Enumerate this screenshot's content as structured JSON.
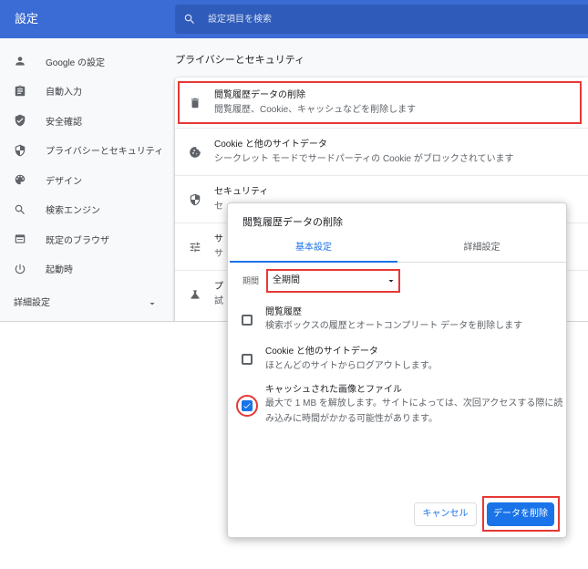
{
  "colors": {
    "toolbar_background": "#3b6cd5",
    "search_field_background": "#2f5bba",
    "accent": "#1a73e8",
    "annotation": "#e53935"
  },
  "toolbar": {
    "title": "設定",
    "search_icon": "search-icon",
    "search_placeholder": "設定項目を検索"
  },
  "sidebar": {
    "items": [
      {
        "icon": "person-icon",
        "label": "Google の設定"
      },
      {
        "icon": "clipboard-icon",
        "label": "自動入力"
      },
      {
        "icon": "verified-shield-icon",
        "label": "安全確認"
      },
      {
        "icon": "security-shield-icon",
        "label": "プライバシーとセキュリティ"
      },
      {
        "icon": "palette-icon",
        "label": "デザイン"
      },
      {
        "icon": "search-icon",
        "label": "検索エンジン"
      },
      {
        "icon": "browser-window-icon",
        "label": "既定のブラウザ"
      },
      {
        "icon": "power-icon",
        "label": "起動時"
      }
    ],
    "advanced": {
      "label": "詳細設定",
      "icon": "arrow-drop-down-icon"
    }
  },
  "privacy_section": {
    "title": "プライバシーとセキュリティ",
    "rows": [
      {
        "icon": "trash-icon",
        "title": "閲覧履歴データの削除",
        "subtitle": "閲覧履歴、Cookie、キャッシュなどを削除します",
        "highlighted": true
      },
      {
        "icon": "cookie-icon",
        "title": "Cookie と他のサイトデータ",
        "subtitle": "シークレット モードでサードパーティの Cookie がブロックされています"
      },
      {
        "icon": "security-shield-icon",
        "title": "セキュリティ",
        "subtitle": "セ"
      },
      {
        "icon": "tune-icon",
        "title": "サ",
        "subtitle": "サ"
      },
      {
        "icon": "flask-icon",
        "title": "プ",
        "subtitle": "試"
      }
    ]
  },
  "clear_data_dialog": {
    "title": "閲覧履歴データの削除",
    "tabs": [
      {
        "label": "基本設定",
        "selected": true
      },
      {
        "label": "詳細設定",
        "selected": false
      }
    ],
    "time_range": {
      "label": "期間",
      "value": "全期間",
      "icon": "arrow-drop-down-icon",
      "highlighted": true
    },
    "options": [
      {
        "title": "閲覧履歴",
        "description": [
          "検索ボックスの履歴とオートコンプリート データを削除します"
        ],
        "checked": false
      },
      {
        "title": "Cookie と他のサイトデータ",
        "description": [
          "ほとんどのサイトからログアウトします。"
        ],
        "checked": false
      },
      {
        "title": "キャッシュされた画像とファイル",
        "description": [
          "最大で 1 MB を解放します。サイトによっては、次回アクセスする際に読",
          "み込みに時間がかかる可能性があります。"
        ],
        "checked": true,
        "highlighted": true
      }
    ],
    "cancel_label": "キャンセル",
    "confirm_label": "データを削除",
    "confirm_highlighted": true
  }
}
